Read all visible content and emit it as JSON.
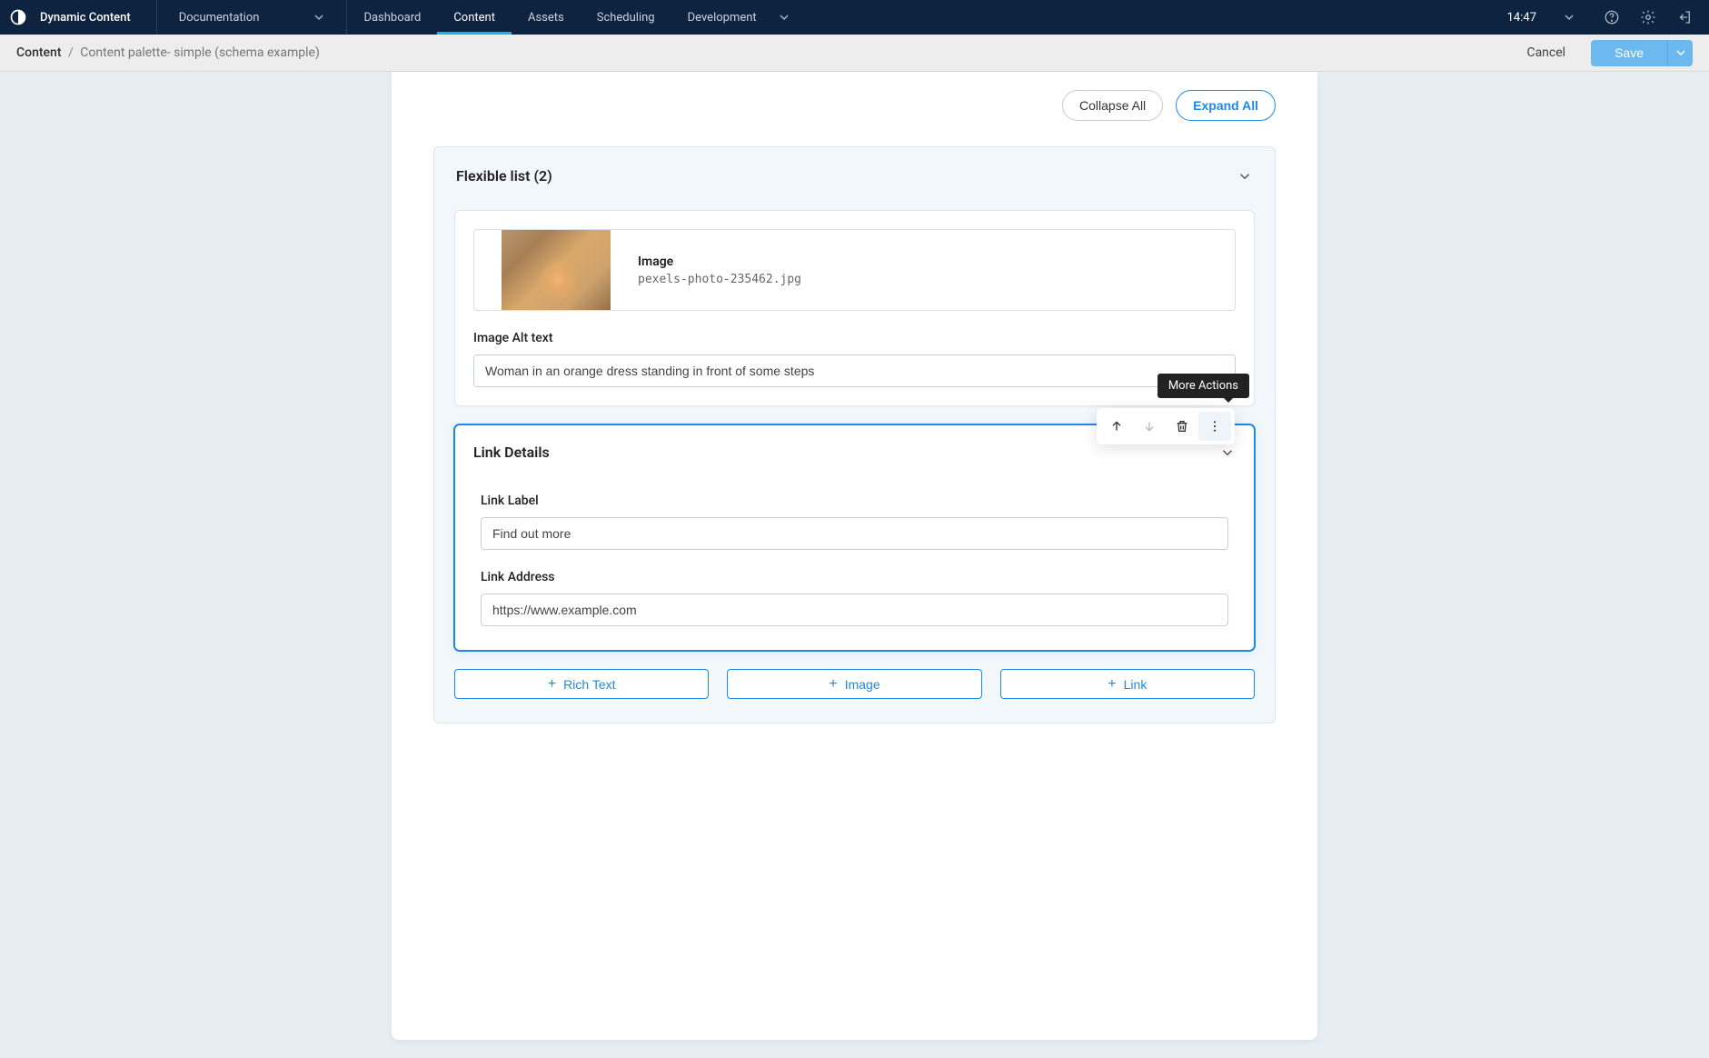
{
  "topnav": {
    "brand": "Dynamic Content",
    "doc_label": "Documentation",
    "items": [
      "Dashboard",
      "Content",
      "Assets",
      "Scheduling"
    ],
    "active_index": 1,
    "dev_label": "Development",
    "time": "14:47"
  },
  "subbar": {
    "crumb_root": "Content",
    "crumb_leaf": "Content palette- simple (schema example)",
    "cancel": "Cancel",
    "save": "Save"
  },
  "panel": {
    "collapse_all": "Collapse All",
    "expand_all": "Expand All",
    "flex_title": "Flexible list (2)",
    "image_item": {
      "type_label": "Image",
      "filename": "pexels-photo-235462.jpg",
      "alt_label": "Image Alt text",
      "alt_value": "Woman in an orange dress standing in front of some steps"
    },
    "tooltip": "More Actions",
    "link_item": {
      "title": "Link Details",
      "label_label": "Link Label",
      "label_value": "Find out more",
      "address_label": "Link Address",
      "address_value": "https://www.example.com"
    },
    "add_buttons": [
      "Rich Text",
      "Image",
      "Link"
    ]
  }
}
